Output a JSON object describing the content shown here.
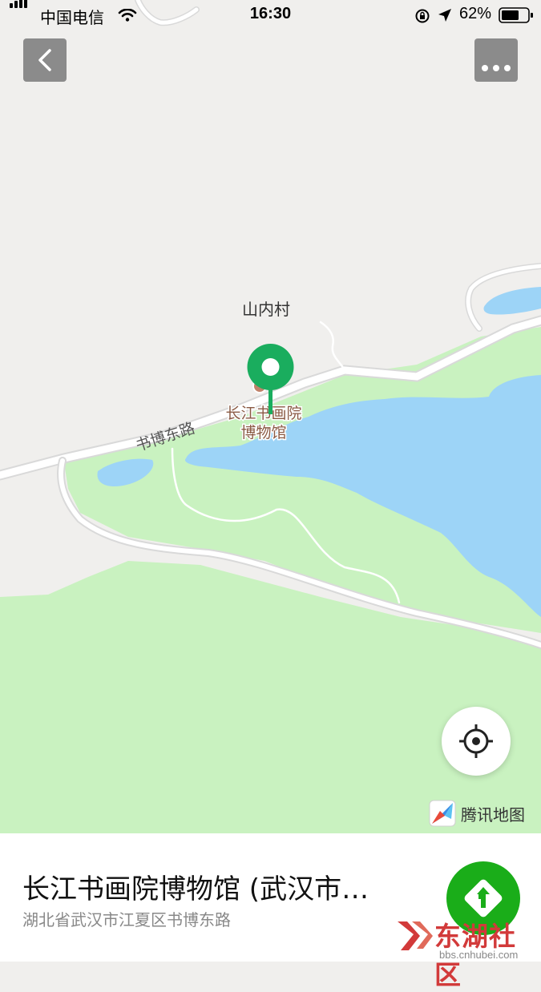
{
  "status_bar": {
    "carrier": "中国电信",
    "time": "16:30",
    "battery": "62%"
  },
  "map": {
    "labels": {
      "village": "山内村",
      "road": "书博东路",
      "poi_line1": "长江书画院",
      "poi_line2": "博物馆"
    },
    "brand": "腾讯地图",
    "colors": {
      "land": "#f0efed",
      "park": "#c9f2c0",
      "water": "#9dd4f7",
      "road": "#ffffff",
      "pin": "#1aad5e",
      "poi_text": "#8a5a44"
    }
  },
  "buttons": {
    "back_icon": "chevron-left-icon",
    "more_icon": "more-dots-icon",
    "locate_icon": "locate-crosshair-icon",
    "route_icon": "route-arrow-icon"
  },
  "place": {
    "title": "长江书画院博物馆 (武汉市…",
    "address": "湖北省武汉市江夏区书博东路"
  },
  "watermark": {
    "text": "东湖社区",
    "url": "bbs.cnhubei.com"
  }
}
